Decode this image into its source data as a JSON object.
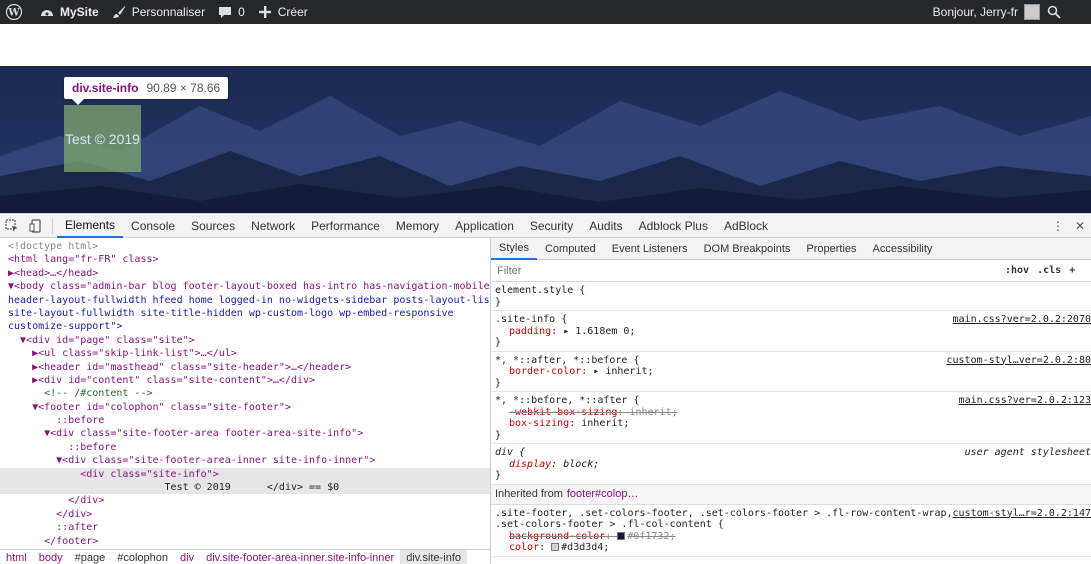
{
  "adminbar": {
    "site_name": "MySite",
    "customize": "Personnaliser",
    "comments_count": "0",
    "create": "Créer",
    "greeting": "Bonjour, Jerry-fr"
  },
  "inspector_tooltip": {
    "tag": "div.site-info",
    "dims": "90.89 × 78.66"
  },
  "site_info_text": "Test © 2019",
  "devtools": {
    "tabs": [
      "Elements",
      "Console",
      "Sources",
      "Network",
      "Performance",
      "Memory",
      "Application",
      "Security",
      "Audits",
      "Adblock Plus",
      "AdBlock"
    ],
    "elements_lines": [
      "<!doctype html>",
      "<html lang=\"fr-FR\" class>",
      "▶<head>…</head>",
      "▼<body class=\"admin-bar blog footer-layout-boxed has-intro has-navigation-mobile",
      "header-layout-fullwidth hfeed home logged-in no-widgets-sidebar posts-layout-list",
      "site-layout-fullwidth site-title-hidden wp-custom-logo wp-embed-responsive",
      "customize-support\">",
      "  ▼<div id=\"page\" class=\"site\">",
      "    ▶<ul class=\"skip-link-list\">…</ul>",
      "    ▶<header id=\"masthead\" class=\"site-header\">…</header>",
      "    ▶<div id=\"content\" class=\"site-content\">…</div>",
      "      <!-- /#content -->",
      "    ▼<footer id=\"colophon\" class=\"site-footer\">",
      "        ::before",
      "      ▼<div class=\"site-footer-area footer-area-site-info\">",
      "          ::before",
      "        ▼<div class=\"site-footer-area-inner site-info-inner\">",
      "            <div class=\"site-info\">",
      "                          Test © 2019      </div> == $0",
      "          </div>",
      "        </div>",
      "        ::after",
      "      </footer>"
    ],
    "breadcrumbs": [
      "html",
      "body",
      "#page",
      "#colophon",
      "div",
      "div.site-footer-area-inner.site-info-inner",
      "div.site-info"
    ],
    "styles_tabs": [
      "Styles",
      "Computed",
      "Event Listeners",
      "DOM Breakpoints",
      "Properties",
      "Accessibility"
    ],
    "filter_placeholder": "Filter",
    "hov": ":hov",
    "cls": ".cls",
    "rules": {
      "element_style": "element.style {",
      "r1_sel": ".site-info {",
      "r1_src": "main.css?ver=2.0.2:2070",
      "r1_prop": "padding",
      "r1_val": "1.618em 0;",
      "r2_sel": "*, *::after, *::before {",
      "r2_src": "custom-styl…ver=2.0.2:80",
      "r2_prop": "border-color",
      "r2_val": "inherit;",
      "r3_sel": "*, *::before, *::after {",
      "r3_src": "main.css?ver=2.0.2:123",
      "r3_prop1": "-webkit-box-sizing",
      "r3_val1": "inherit;",
      "r3_prop2": "box-sizing",
      "r3_val2": "inherit;",
      "r4_sel": "div {",
      "r4_src": "user agent stylesheet",
      "r4_prop": "display",
      "r4_val": "block;",
      "inherited_label": "Inherited from",
      "inherited_tag": "footer",
      "inherited_id": "#colop…",
      "r5_sel1": ".site-footer, .set-colors-footer, .set-colors-footer > .fl-row-content-wrap,",
      "r5_sel2": ".set-colors-footer > .fl-col-content {",
      "r5_src": "custom-styl…r=2.0.2:147",
      "r5_prop1": "background-color",
      "r5_val1": "#0f1732;",
      "r5_prop2": "color",
      "r5_val2": "#d3d3d4;"
    },
    "colors": {
      "bg1": "#0f1732",
      "bg2": "#d3d3d4"
    }
  }
}
